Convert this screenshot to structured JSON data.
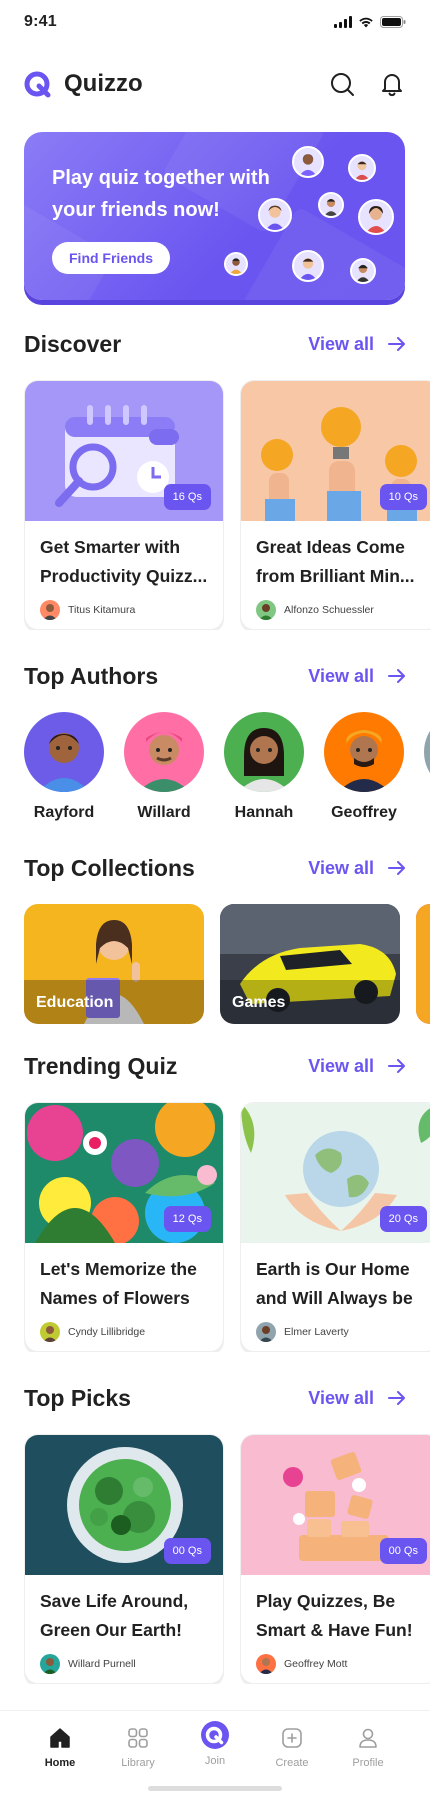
{
  "status_bar": {
    "time": "9:41"
  },
  "app": {
    "name": "Quizzo"
  },
  "banner": {
    "title": "Play quiz together with your friends now!",
    "button_label": "Find Friends"
  },
  "sections": {
    "discover": {
      "title": "Discover",
      "view_all": "View all"
    },
    "top_authors": {
      "title": "Top Authors",
      "view_all": "View all"
    },
    "top_collections": {
      "title": "Top Collections",
      "view_all": "View all"
    },
    "trending": {
      "title": "Trending Quiz",
      "view_all": "View all"
    },
    "top_picks": {
      "title": "Top Picks",
      "view_all": "View all"
    }
  },
  "discover": [
    {
      "title_line1": "Get Smarter with",
      "title_line2": "Productivity Quizz...",
      "qs": "16 Qs",
      "author": "Titus Kitamura"
    },
    {
      "title_line1": "Great Ideas Come",
      "title_line2": "from Brilliant Min...",
      "qs": "10 Qs",
      "author": "Alfonzo Schuessler"
    }
  ],
  "authors": [
    {
      "name": "Rayford"
    },
    {
      "name": "Willard"
    },
    {
      "name": "Hannah"
    },
    {
      "name": "Geoffrey"
    }
  ],
  "collections": [
    {
      "label": "Education"
    },
    {
      "label": "Games"
    }
  ],
  "trending": [
    {
      "title_line1": "Let's Memorize the",
      "title_line2": "Names of Flowers",
      "qs": "12 Qs",
      "author": "Cyndy Lillibridge"
    },
    {
      "title_line1": "Earth is Our Home",
      "title_line2": "and Will Always be",
      "qs": "20 Qs",
      "author": "Elmer Laverty"
    }
  ],
  "top_picks": [
    {
      "title_line1": "Save Life Around,",
      "title_line2": "Green Our Earth!",
      "qs": "00 Qs",
      "author": "Willard Purnell"
    },
    {
      "title_line1": "Play Quizzes, Be",
      "title_line2": "Smart & Have Fun!",
      "qs": "00 Qs",
      "author": "Geoffrey Mott"
    }
  ],
  "bottom_nav": [
    {
      "label": "Home",
      "icon": "home-icon",
      "active": true
    },
    {
      "label": "Library",
      "icon": "library-icon",
      "active": false
    },
    {
      "label": "Join",
      "icon": "join-icon",
      "active": false
    },
    {
      "label": "Create",
      "icon": "create-icon",
      "active": false
    },
    {
      "label": "Profile",
      "icon": "profile-icon",
      "active": false
    }
  ],
  "colors": {
    "primary": "#6A55F0",
    "text": "#212121",
    "muted": "#9E9E9E"
  }
}
